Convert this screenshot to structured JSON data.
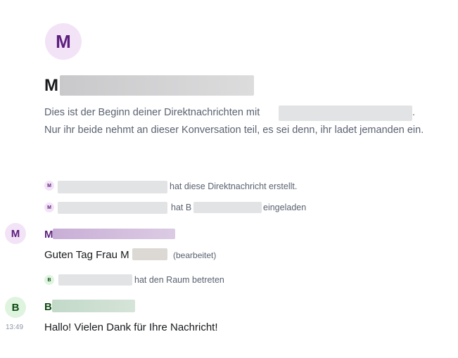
{
  "header": {
    "avatar_letter": "M",
    "room_title_visible": "M",
    "intro_line1": "Dies ist der Beginn deiner Direktnachrichten mit",
    "intro_line1_tail": ".",
    "intro_line2": "Nur ihr beide nehmt an dieser Konversation teil, es sei denn, ihr ladet jemanden ein."
  },
  "events": [
    {
      "avatar_letter": "M",
      "text": "hat diese Direktnachricht erstellt."
    },
    {
      "avatar_letter": "M",
      "text_before": "hat B",
      "text_after": "eingeladen"
    }
  ],
  "messages": [
    {
      "avatar_letter": "M",
      "sender_visible": "M",
      "body_visible": "Guten Tag Frau M",
      "edited_label": "(bearbeitet)"
    },
    {
      "avatar_letter": "B",
      "sender_visible": "B",
      "timestamp": "13:49",
      "body": "Hallo! Vielen Dank für Ihre Nachricht!"
    }
  ],
  "join_event": {
    "avatar_letter": "B",
    "text": "hat den Raum betreten"
  },
  "colors": {
    "user_m_accent": "#5c1f7e",
    "user_m_bg": "#f3e3f6",
    "user_b_accent": "#0d4a12",
    "user_b_bg": "#dff4df",
    "muted_text": "#5a6270"
  }
}
